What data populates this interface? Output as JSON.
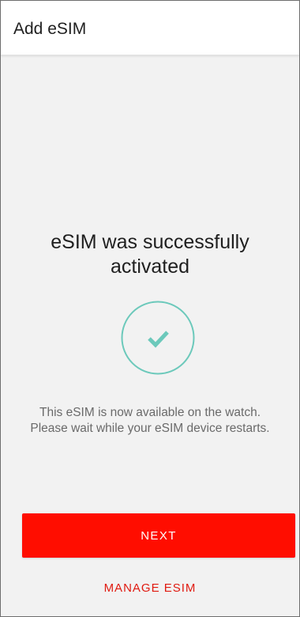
{
  "header": {
    "title": "Add eSIM"
  },
  "status": {
    "headline_line1": "eSIM was successfully",
    "headline_line2": "activated",
    "message_line1": "This eSIM is now available on the watch.",
    "message_line2": "Please wait while your eSIM device restarts.",
    "icon": "check-circle-icon"
  },
  "actions": {
    "next_label": "NEXT",
    "manage_label": "MANAGE ESIM"
  },
  "colors": {
    "accent_red": "#ff0d00",
    "link_red": "#e01a10",
    "success_teal": "#6cc9bb",
    "background": "#f2f2f2"
  }
}
